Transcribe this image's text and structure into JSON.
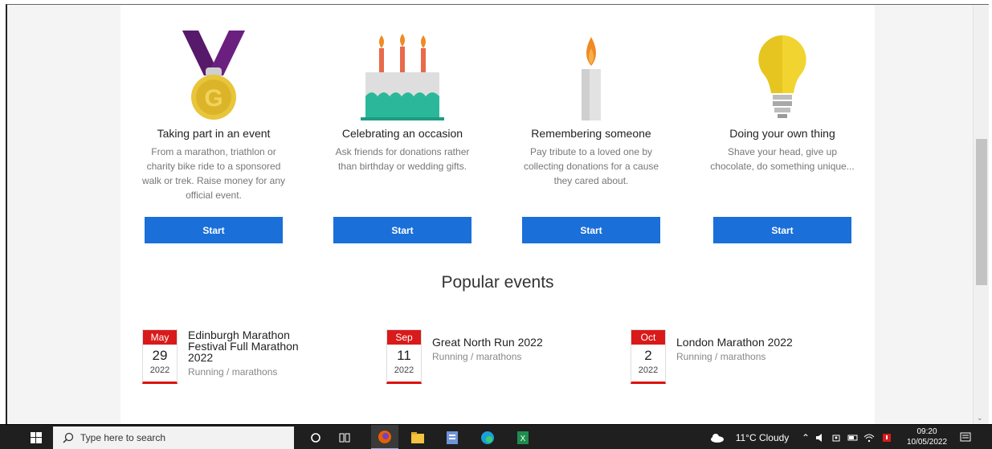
{
  "cards": [
    {
      "title": "Taking part in an event",
      "desc": "From a marathon, triathlon or charity bike ride to a sponsored walk or trek. Raise money for any official event.",
      "button": "Start",
      "icon": "medal-icon"
    },
    {
      "title": "Celebrating an occasion",
      "desc": "Ask friends for donations rather than birthday or wedding gifts.",
      "button": "Start",
      "icon": "cake-icon"
    },
    {
      "title": "Remembering someone",
      "desc": "Pay tribute to a loved one by collecting donations for a cause they cared about.",
      "button": "Start",
      "icon": "candle-icon"
    },
    {
      "title": "Doing your own thing",
      "desc": "Shave your head, give up chocolate, do something unique...",
      "button": "Start",
      "icon": "lightbulb-icon"
    }
  ],
  "popular": {
    "title": "Popular events",
    "events": [
      {
        "month": "May",
        "day": "29",
        "year": "2022",
        "name": "Edinburgh Marathon Festival Full Marathon 2022",
        "category": "Running / marathons"
      },
      {
        "month": "Sep",
        "day": "11",
        "year": "2022",
        "name": "Great North Run 2022",
        "category": "Running / marathons"
      },
      {
        "month": "Oct",
        "day": "2",
        "year": "2022",
        "name": "London Marathon 2022",
        "category": "Running / marathons"
      }
    ]
  },
  "taskbar": {
    "search_placeholder": "Type here to search",
    "weather": "11°C  Cloudy",
    "time": "09:20",
    "date": "10/05/2022"
  },
  "colors": {
    "accent": "#1a6fd8",
    "calendar_red": "#d91a1a",
    "medal_ribbon": "#6b2080",
    "medal_gold": "#e8c53a",
    "cake_teal": "#2bb89a"
  }
}
